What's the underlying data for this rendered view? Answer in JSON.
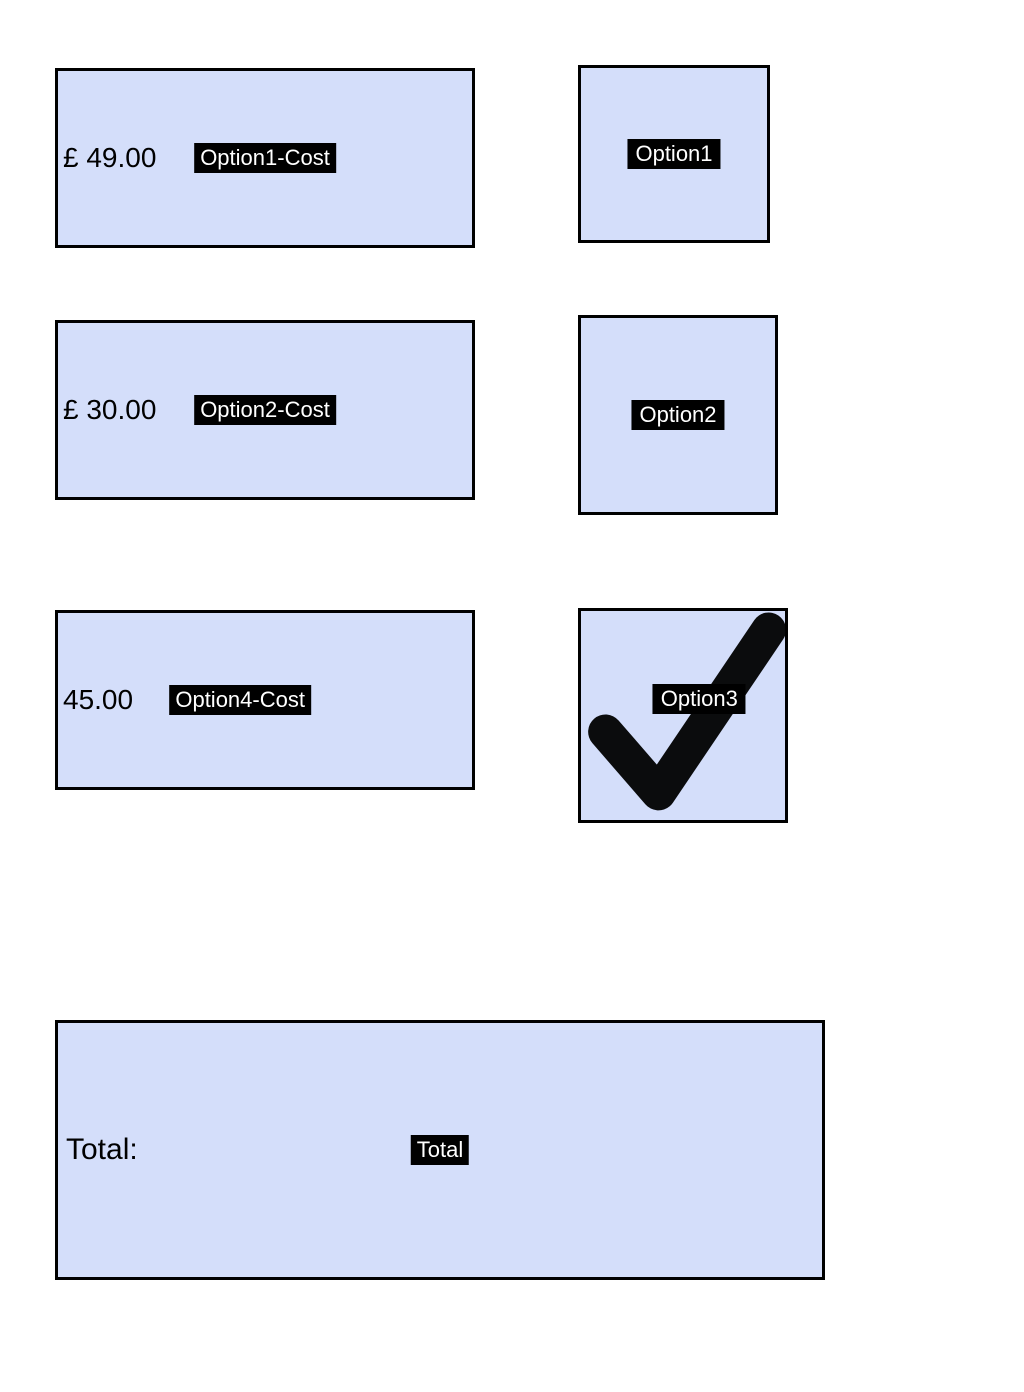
{
  "rows": [
    {
      "value": "£ 49.00",
      "cost_label": "Option1-Cost",
      "option_label": "Option1",
      "checked": false
    },
    {
      "value": "£ 30.00",
      "cost_label": "Option2-Cost",
      "option_label": "Option2",
      "checked": false
    },
    {
      "value": "45.00",
      "cost_label": "Option4-Cost",
      "option_label": "Option3",
      "checked": true
    }
  ],
  "total": {
    "label": "Total:",
    "badge": "Total"
  },
  "colors": {
    "box_fill": "#d4defa",
    "box_border": "#000000",
    "badge_bg": "#000000",
    "badge_fg": "#ffffff"
  }
}
